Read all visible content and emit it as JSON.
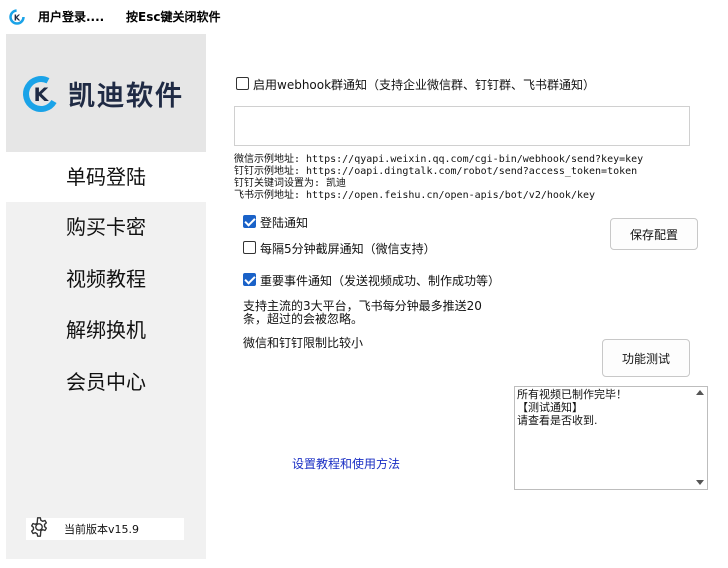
{
  "window": {
    "title": "用户登录....",
    "esc_hint": "按Esc键关闭软件"
  },
  "brand": {
    "name": "凯迪软件",
    "accent": "#1aa3e8"
  },
  "sidebar": {
    "items": [
      {
        "label": "单码登陆",
        "active": true
      },
      {
        "label": "购买卡密",
        "active": false
      },
      {
        "label": "视频教程",
        "active": false
      },
      {
        "label": "解绑换机",
        "active": false
      },
      {
        "label": "会员中心",
        "active": false
      }
    ],
    "version": "当前版本v15.9",
    "settings_icon": "gear-icon"
  },
  "webhook": {
    "enable_label": "启用webhook群通知（支持企业微信群、钉钉群、飞书群通知）",
    "enabled": false,
    "input_value": "",
    "examples": [
      "微信示例地址: https://qyapi.weixin.qq.com/cgi-bin/webhook/send?key=key",
      "钉钉示例地址: https://oapi.dingtalk.com/robot/send?access_token=token",
      "钉钉关键词设置为: 凯迪",
      "飞书示例地址: https://open.feishu.cn/open-apis/bot/v2/hook/key"
    ]
  },
  "options": {
    "login_notify": {
      "label": "登陆通知",
      "checked": true
    },
    "screenshot_notify": {
      "label": "每隔5分钟截屏通知（微信支持）",
      "checked": false
    },
    "important_notify": {
      "label": "重要事件通知（发送视频成功、制作成功等）",
      "checked": true
    }
  },
  "buttons": {
    "save": "保存配置",
    "test": "功能测试"
  },
  "notes": {
    "line1": "支持主流的3大平台，飞书每分钟最多推送20",
    "line2": "条，超过的会被忽略。",
    "line3": "微信和钉钉限制比较小"
  },
  "help_link": "设置教程和使用方法",
  "log": {
    "lines": [
      "所有视频已制作完毕！",
      "【测试通知】",
      "请查看是否收到."
    ]
  }
}
